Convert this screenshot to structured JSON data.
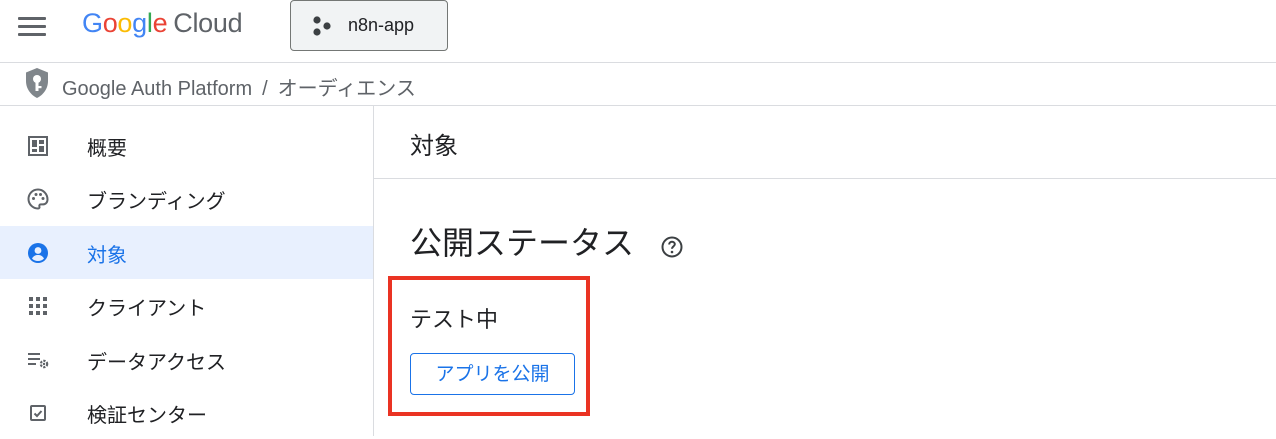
{
  "header": {
    "logo_parts": [
      "G",
      "o",
      "o",
      "g",
      "l",
      "e"
    ],
    "logo_suffix": "Cloud",
    "project_name": "n8n-app"
  },
  "breadcrumb": {
    "root": "Google Auth Platform",
    "separator": "/",
    "current": "オーディエンス"
  },
  "sidebar": {
    "items": [
      {
        "label": "概要",
        "icon": "dashboard-icon"
      },
      {
        "label": "ブランディング",
        "icon": "palette-icon"
      },
      {
        "label": "対象",
        "icon": "account-circle-icon",
        "active": true
      },
      {
        "label": "クライアント",
        "icon": "apps-grid-icon"
      },
      {
        "label": "データアクセス",
        "icon": "data-settings-icon"
      },
      {
        "label": "検証センター",
        "icon": "verified-check-icon"
      }
    ]
  },
  "main": {
    "title": "対象",
    "section_title": "公開ステータス",
    "status": "テスト中",
    "publish_button": "アプリを公開"
  },
  "colors": {
    "accent": "#1a73e8",
    "active_bg": "#e8f0fe",
    "highlight": "#ea3323"
  }
}
